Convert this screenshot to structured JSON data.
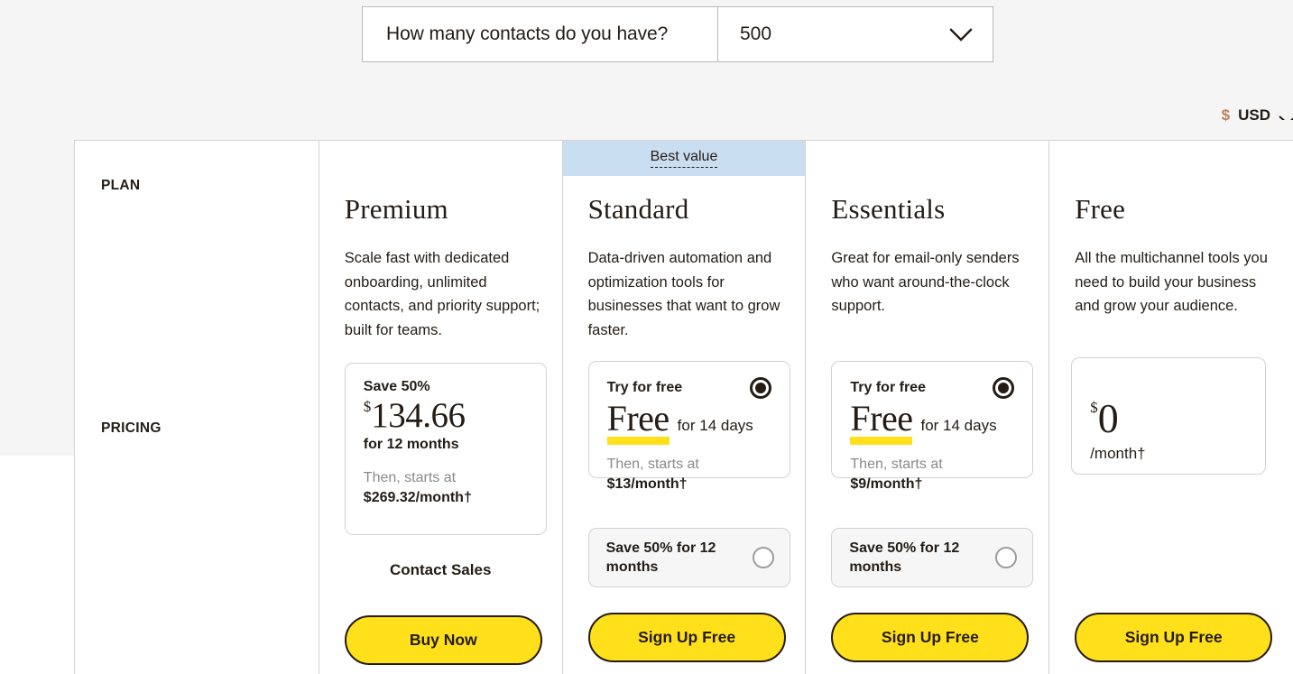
{
  "header": {
    "contacts_question": "How many contacts do you have?",
    "contacts_value": "500",
    "currency_symbol": "$",
    "currency_code": "USD"
  },
  "row_labels": {
    "plan": "PLAN",
    "pricing": "PRICING"
  },
  "best_value_badge": "Best value",
  "plans": [
    {
      "name": "Premium",
      "description": "Scale fast with dedicated onboarding, unlimited contacts, and priority support; built for teams.",
      "save_label": "Save 50%",
      "price_symbol": "$",
      "price_amount": "134.66",
      "price_period": "for 12 months",
      "then_label": "Then, starts at",
      "then_amount": "$269.32/month†",
      "secondary_link": "Contact Sales",
      "cta": "Buy Now"
    },
    {
      "name": "Standard",
      "description": "Data-driven automation and optimization tools for businesses that want to grow faster.",
      "trial_label": "Try for free",
      "trial_word": "Free",
      "trial_days": "for 14 days",
      "then_label": "Then, starts at",
      "then_amount": "$13/month†",
      "trial_selected": true,
      "save_option_label": "Save 50% for 12 months",
      "save_option_selected": false,
      "cta": "Sign Up Free"
    },
    {
      "name": "Essentials",
      "description": "Great for email-only senders who want around-the-clock support.",
      "trial_label": "Try for free",
      "trial_word": "Free",
      "trial_days": "for 14 days",
      "then_label": "Then, starts at",
      "then_amount": "$9/month†",
      "trial_selected": true,
      "save_option_label": "Save 50% for 12 months",
      "save_option_selected": false,
      "cta": "Sign Up Free"
    },
    {
      "name": "Free",
      "description": "All the multichannel tools you need to build your business and grow your audience.",
      "price_symbol": "$",
      "price_amount": "0",
      "price_period": "/month†",
      "cta": "Sign Up Free"
    }
  ],
  "colors": {
    "brand_yellow": "#ffe01b",
    "best_value_blue": "#cadef2",
    "ink": "#241c15",
    "page_gray": "#f5f5f5"
  }
}
